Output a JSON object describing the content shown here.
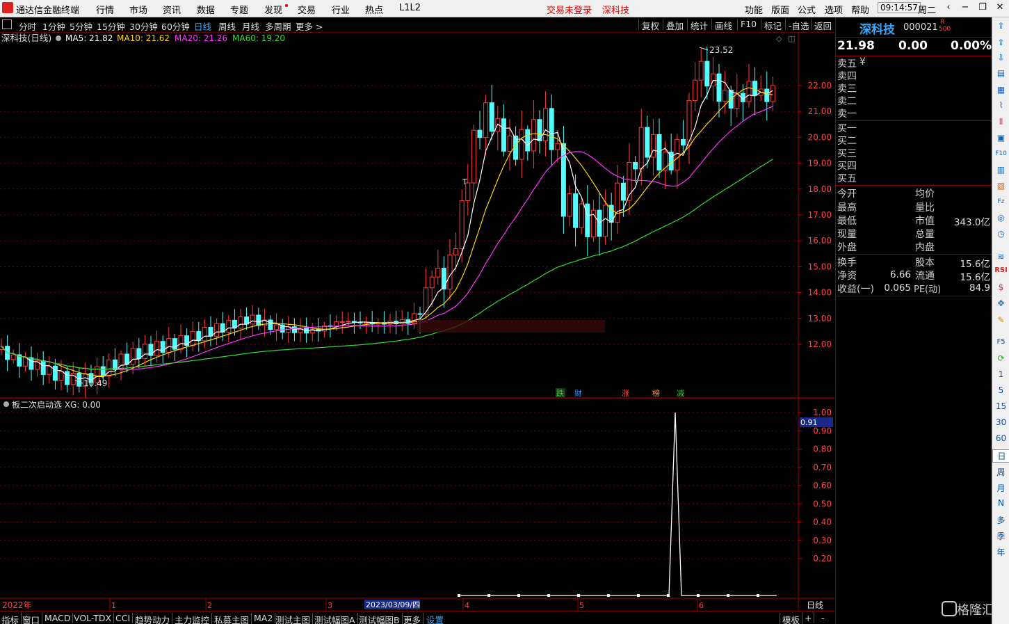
{
  "menubar": {
    "app_title": "通达信金融终端",
    "items": [
      "行情",
      "市场",
      "资讯",
      "数据",
      "专题",
      "发现",
      "交易",
      "行业",
      "热点",
      "L1L2"
    ],
    "status_login": "交易未登录",
    "status_stock": "深科技",
    "right_items": [
      "功能",
      "版面",
      "公式",
      "选项",
      "帮助"
    ],
    "clock": "09:14:57",
    "weekday": "周二"
  },
  "period_toolbar": {
    "items": [
      "分时",
      "1分钟",
      "5分钟",
      "15分钟",
      "30分钟",
      "60分钟",
      "日线",
      "周线",
      "月线",
      "多周期",
      "更多 >"
    ],
    "active_index": 6,
    "right_items": [
      "复权",
      "叠加",
      "统计",
      "画线",
      "F10",
      "标记",
      "-自选",
      "返回"
    ]
  },
  "main_chart": {
    "title": "深科技(日线)",
    "ma": [
      {
        "label": "MA5: 21.82",
        "color": "#ffffff"
      },
      {
        "label": "MA10: 21.62",
        "color": "#ffd700"
      },
      {
        "label": "MA20: 21.26",
        "color": "#ff33ff"
      },
      {
        "label": "MA60: 19.20",
        "color": "#33dd33"
      }
    ],
    "y_ticks": [
      "22.00",
      "21.00",
      "20.00",
      "19.00",
      "18.00",
      "17.00",
      "16.00",
      "15.00",
      "14.00",
      "13.00",
      "12.00"
    ],
    "high_label": "23.52",
    "low_label": "10.49",
    "markers": [
      {
        "text": "跌",
        "color": "#33cc33"
      },
      {
        "text": "财",
        "color": "#3399ff"
      },
      {
        "text": "涨",
        "color": "#ff4444"
      },
      {
        "text": "榜",
        "color": "#ff9933"
      },
      {
        "text": "减",
        "color": "#33cc33"
      }
    ],
    "t_marker": "T"
  },
  "indicator": {
    "title": "板二次启动选 XG: 0.00",
    "y_ticks": [
      "1.00",
      "0.90",
      "0.80",
      "0.70",
      "0.60",
      "0.50",
      "0.40",
      "0.30",
      "0.20"
    ],
    "current_value": "0.91"
  },
  "x_axis": {
    "year_label": "2022年",
    "month_labels": [
      "1",
      "2",
      "3",
      "4",
      "5",
      "6"
    ],
    "highlight_date": "2023/03/09/四",
    "period_label": "日线"
  },
  "quote": {
    "name": "深科技",
    "code": "000021",
    "badge_top": "R",
    "badge_bottom": "500",
    "price": "21.98",
    "change": "0.00",
    "change_pct": "0.00%",
    "sell_levels": [
      "卖五",
      "卖四",
      "卖三",
      "卖二",
      "卖一"
    ],
    "yen_mark": "¥",
    "buy_levels": [
      "买一",
      "买二",
      "买三",
      "买四",
      "买五"
    ],
    "stats_left": [
      "今开",
      "最高",
      "最低",
      "现量",
      "外盘"
    ],
    "stats_right": [
      "均价",
      "量比",
      "市值",
      "总量",
      "内盘"
    ],
    "market_cap": "343.0亿",
    "fund_rows": [
      {
        "l1": "换手",
        "v1": "",
        "l2": "股本",
        "v2": "15.6亿"
      },
      {
        "l1": "净资",
        "v1": "6.66",
        "l2": "流通",
        "v2": "15.6亿"
      },
      {
        "l1": "收益(一)",
        "v1": "0.065",
        "l2": "PE(动)",
        "v2": "84.9"
      }
    ]
  },
  "vtool": {
    "text_items": [
      "RSI",
      "F5",
      "1",
      "5",
      "15",
      "30",
      "60",
      "日",
      "周",
      "月",
      "N",
      "多",
      "季",
      "年"
    ]
  },
  "tabbar": {
    "items": [
      "指标",
      "窗口",
      "MACD",
      "VOL-TDX",
      "CCI",
      "趋势动力",
      "主力监控",
      "私募主图",
      "MA2",
      "测试主图",
      "测试幅图A",
      "测试幅图B",
      "更多",
      "设置"
    ],
    "active_index": 13,
    "right_items": [
      "模板",
      "+",
      "-"
    ]
  },
  "watermark": "格隆汇",
  "chart_data": {
    "type": "candlestick",
    "title": "深科技(日线)",
    "ylim": [
      10.3,
      23.8
    ],
    "high": 23.52,
    "low": 10.49,
    "ma_last": {
      "MA5": 21.82,
      "MA10": 21.62,
      "MA20": 21.26,
      "MA60": 19.2
    },
    "indicator": {
      "name": "板二次启动选",
      "xg": 0.0,
      "ylim": [
        0,
        1.0
      ],
      "spike_value": 1.0
    }
  }
}
